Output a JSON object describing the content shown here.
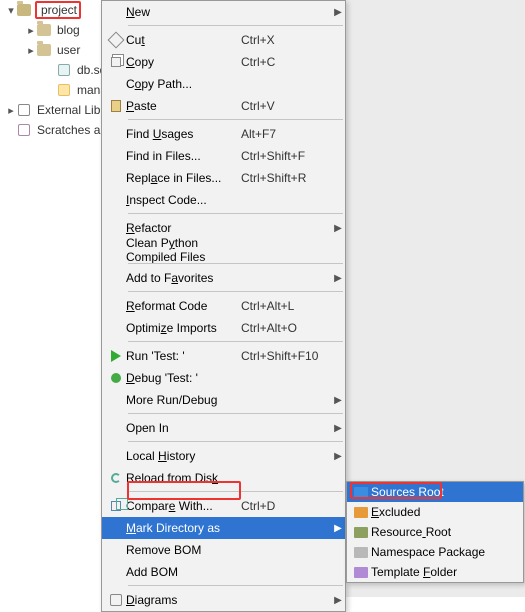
{
  "tree": {
    "root": "project",
    "blog": "blog",
    "user": "user",
    "db": "db.sqlite",
    "manage": "manage.",
    "ext_lib": "External Lib",
    "scratches": "Scratches a"
  },
  "menu": [
    {
      "icon": "",
      "label_html": "<span class='mnemonic'>N</span>ew",
      "key": "",
      "sub": true
    },
    {
      "sep": true
    },
    {
      "icon": "cut",
      "label_html": "Cu<span class='mnemonic'>t</span>",
      "key": "Ctrl+X"
    },
    {
      "icon": "copy",
      "label_html": "<span class='mnemonic'>C</span>opy",
      "key": "Ctrl+C"
    },
    {
      "icon": "",
      "label_html": "C<span class='mnemonic'>o</span>py Path...",
      "key": ""
    },
    {
      "icon": "paste",
      "label_html": "<span class='mnemonic'>P</span>aste",
      "key": "Ctrl+V"
    },
    {
      "sep": true
    },
    {
      "icon": "",
      "label_html": "Find <span class='mnemonic'>U</span>sages",
      "key": "Alt+F7"
    },
    {
      "icon": "",
      "label_html": "Find in Files...",
      "key": "Ctrl+Shift+F"
    },
    {
      "icon": "",
      "label_html": "Repl<span class='mnemonic'>a</span>ce in Files...",
      "key": "Ctrl+Shift+R"
    },
    {
      "icon": "",
      "label_html": "<span class='mnemonic'>I</span>nspect Code...",
      "key": ""
    },
    {
      "sep": true
    },
    {
      "icon": "",
      "label_html": "<span class='mnemonic'>R</span>efactor",
      "key": "",
      "sub": true
    },
    {
      "icon": "",
      "label_html": "Clean P<span class='mnemonic'>y</span>thon Compiled Files",
      "key": ""
    },
    {
      "sep": true
    },
    {
      "icon": "",
      "label_html": "Add to F<span class='mnemonic'>a</span>vorites",
      "key": "",
      "sub": true
    },
    {
      "sep": true
    },
    {
      "icon": "",
      "label_html": "<span class='mnemonic'>R</span>eformat Code",
      "key": "Ctrl+Alt+L"
    },
    {
      "icon": "",
      "label_html": "Optimi<span class='mnemonic'>z</span>e Imports",
      "key": "Ctrl+Alt+O"
    },
    {
      "sep": true
    },
    {
      "icon": "run",
      "label_html": "Run 'Test: '",
      "key": "Ctrl+Shift+F10"
    },
    {
      "icon": "bug",
      "label_html": "<span class='mnemonic'>D</span>ebug 'Test: '",
      "key": ""
    },
    {
      "icon": "",
      "label_html": "More Run/Debug",
      "key": "",
      "sub": true
    },
    {
      "sep": true
    },
    {
      "icon": "",
      "label_html": "Open In",
      "key": "",
      "sub": true
    },
    {
      "sep": true
    },
    {
      "icon": "",
      "label_html": "Local <span class='mnemonic'>H</span>istory",
      "key": "",
      "sub": true
    },
    {
      "icon": "reload",
      "label_html": "Reload from Dis<span class='mnemonic'>k</span>",
      "key": ""
    },
    {
      "sep": true
    },
    {
      "icon": "compare",
      "label_html": "Compar<span class='mnemonic'>e</span> With...",
      "key": "Ctrl+D"
    },
    {
      "icon": "",
      "label_html": "<span class='mnemonic'>M</span>ark Directory as",
      "key": "",
      "sub": true,
      "selected": true
    },
    {
      "icon": "",
      "label_html": "Remove BOM",
      "key": ""
    },
    {
      "icon": "",
      "label_html": "Add BOM",
      "key": ""
    },
    {
      "sep": true
    },
    {
      "icon": "diag",
      "label_html": "<span class='mnemonic'>D</span>iagrams",
      "key": "",
      "sub": true
    }
  ],
  "submenu": [
    {
      "color": "fc-blue",
      "label": "Sources Root",
      "selected": true,
      "u": 0
    },
    {
      "color": "fc-orange",
      "label": "Excluded",
      "u": 0
    },
    {
      "color": "fc-olive",
      "label": "Resource Root",
      "u": 8
    },
    {
      "color": "fc-gray",
      "label": "Namespace Package"
    },
    {
      "color": "fc-violet",
      "label": "Template Folder",
      "u": 9
    }
  ]
}
